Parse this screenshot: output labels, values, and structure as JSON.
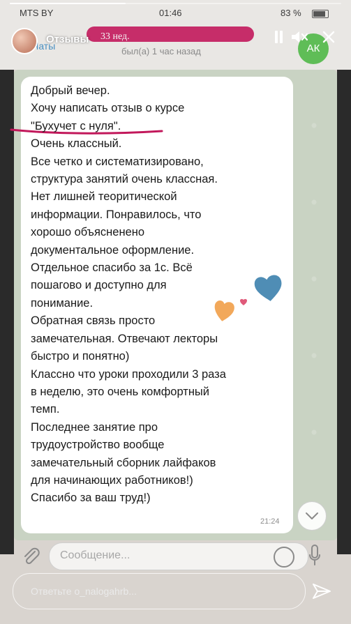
{
  "status_bar": {
    "carrier": "MTS BY",
    "time": "01:46",
    "battery": "83 %",
    "battery_level": 0.83
  },
  "story": {
    "title": "Отзывы",
    "time_ago": "33 нед.",
    "progress": 0.35,
    "reply_placeholder": "Ответьте o_nalogahrb..."
  },
  "chat": {
    "back_label": "Чаты",
    "contact_status": "был(а) 1 час назад",
    "avatar_initials": "АК",
    "composer_placeholder": "Сообщение...",
    "message": {
      "text": "Добрый вечер.\nХочу написать отзыв о курсе\n\"Бухучет с нуля\".\nОчень классный.\nВсе четко и систематизировано,\nструктура занятий очень классная.\nНет лишней теоритической\nинформации. Понравилось, что\nхорошо объясненено\nдокументальное оформление.\nОтдельное спасибо за 1с. Всё\nпошагово и доступно для\nпонимание.\nОбратная связь просто\nзамечательная. Отвечают лекторы\nбыстро и понятно)\nКлассно что уроки проходили 3 раза\nв неделю, это очень комфортный\nтемп.\nПоследнее занятие про\nтрудоустройство вообще\nзамечательный сборник лайфаков\nдля начинающих работников!)\nСпасибо за ваш труд!)",
      "time": "21:24"
    }
  },
  "colors": {
    "accent": "#c2185b",
    "heart_blue": "#4f8db5",
    "heart_orange": "#f2a85a",
    "heart_pink": "#e05a7a",
    "avatar_green": "#5fbd57",
    "bubble": "#ffffff"
  },
  "icons": [
    "pause-icon",
    "mute-icon",
    "close-icon",
    "attach-icon",
    "sticker-icon",
    "mic-icon",
    "send-icon",
    "chevron-down-icon",
    "heart-icon"
  ]
}
